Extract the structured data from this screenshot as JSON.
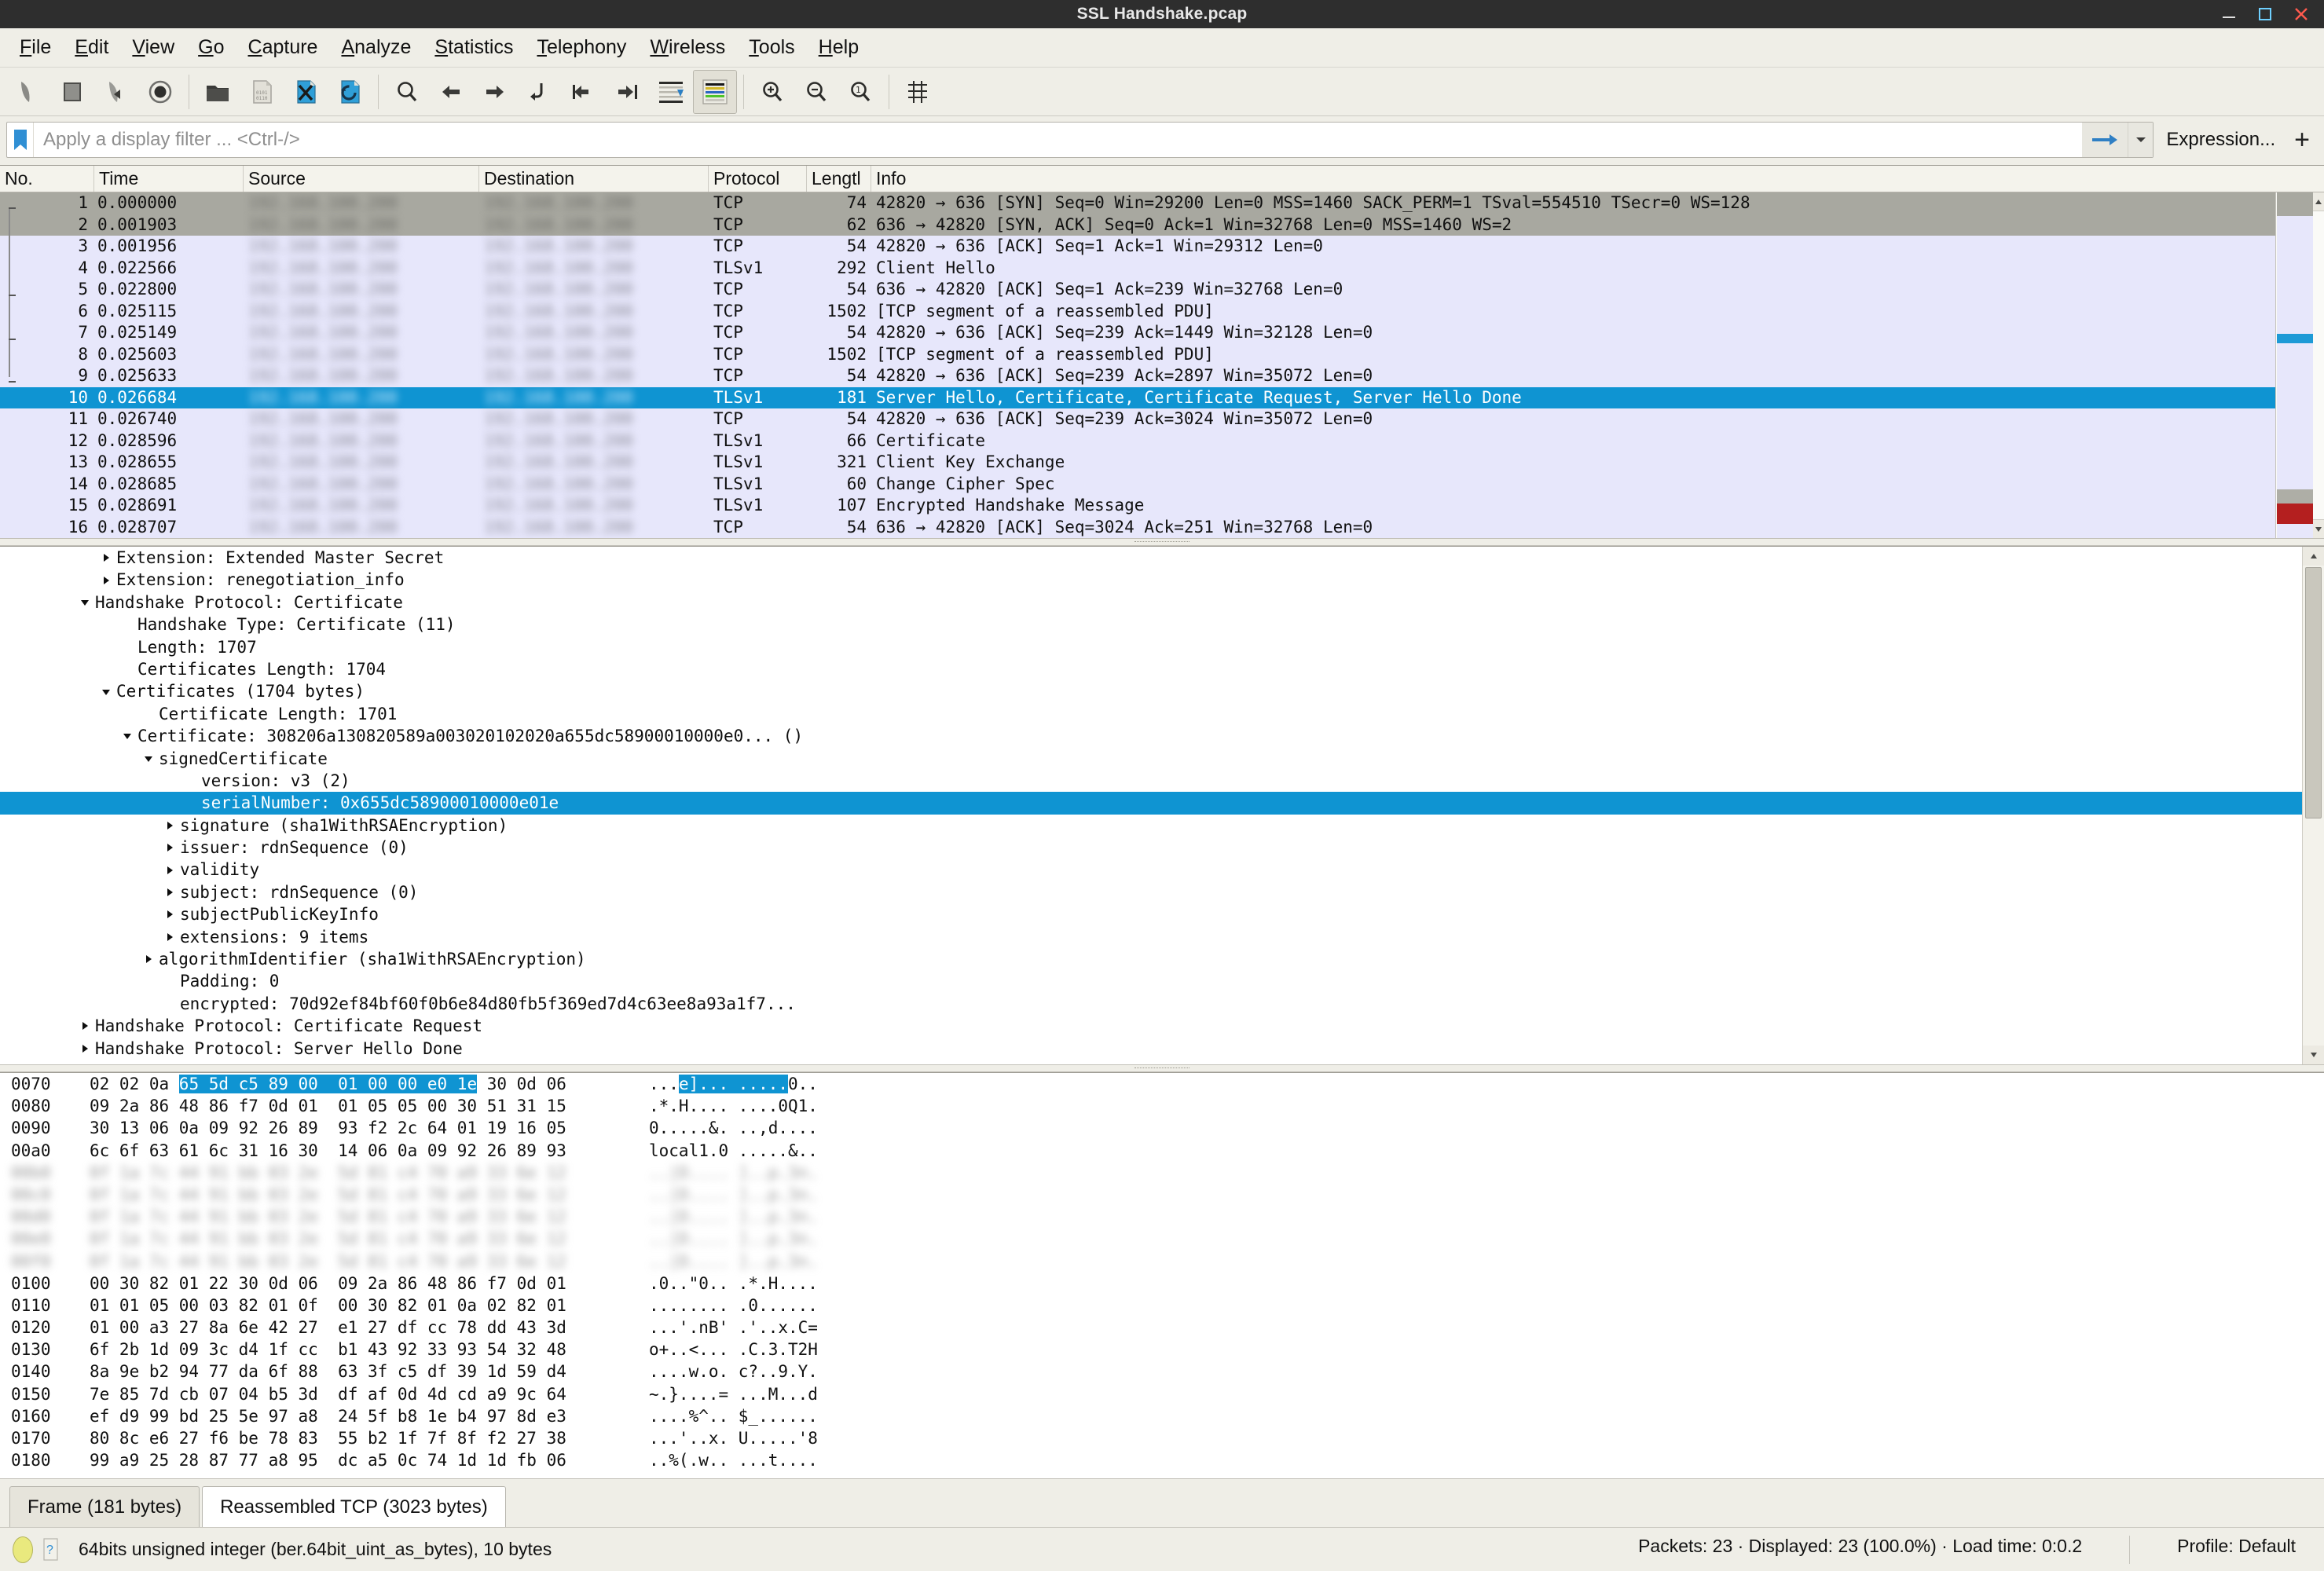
{
  "window": {
    "title": "SSL Handshake.pcap",
    "minimize_label": "Minimize",
    "maximize_label": "Maximize",
    "close_label": "Close"
  },
  "menubar": {
    "items": [
      {
        "label": "File",
        "mnemonic": "F"
      },
      {
        "label": "Edit",
        "mnemonic": "E"
      },
      {
        "label": "View",
        "mnemonic": "V"
      },
      {
        "label": "Go",
        "mnemonic": "G"
      },
      {
        "label": "Capture",
        "mnemonic": "C"
      },
      {
        "label": "Analyze",
        "mnemonic": "A"
      },
      {
        "label": "Statistics",
        "mnemonic": "S"
      },
      {
        "label": "Telephony",
        "mnemonic": "T"
      },
      {
        "label": "Wireless",
        "mnemonic": "W"
      },
      {
        "label": "Tools",
        "mnemonic": "T"
      },
      {
        "label": "Help",
        "mnemonic": "H"
      }
    ]
  },
  "toolbar": {
    "buttons": [
      {
        "icon": "start-capture-icon",
        "tooltip": "Start capturing packets"
      },
      {
        "icon": "stop-capture-icon",
        "tooltip": "Stop capturing packets"
      },
      {
        "icon": "restart-capture-icon",
        "tooltip": "Restart current capture"
      },
      {
        "icon": "capture-options-icon",
        "tooltip": "Capture options"
      },
      {
        "icon": "open-file-icon",
        "tooltip": "Open a capture file"
      },
      {
        "icon": "save-file-icon",
        "tooltip": "Save this capture file"
      },
      {
        "icon": "close-file-icon",
        "tooltip": "Close this capture file"
      },
      {
        "icon": "reload-file-icon",
        "tooltip": "Reload this file"
      },
      {
        "icon": "find-packet-icon",
        "tooltip": "Find a packet"
      },
      {
        "icon": "go-back-icon",
        "tooltip": "Go back in packet history"
      },
      {
        "icon": "go-forward-icon",
        "tooltip": "Go forward in packet history"
      },
      {
        "icon": "go-to-packet-icon",
        "tooltip": "Go to a specific packet"
      },
      {
        "icon": "go-first-packet-icon",
        "tooltip": "Go to the first packet"
      },
      {
        "icon": "go-last-packet-icon",
        "tooltip": "Go to the last packet"
      },
      {
        "icon": "auto-scroll-icon",
        "tooltip": "Auto scroll in live capture"
      },
      {
        "icon": "colorize-packets-icon",
        "tooltip": "Colorize packet list"
      },
      {
        "icon": "zoom-in-icon",
        "tooltip": "Zoom in"
      },
      {
        "icon": "zoom-out-icon",
        "tooltip": "Zoom out"
      },
      {
        "icon": "zoom-reset-icon",
        "tooltip": "Normal size"
      },
      {
        "icon": "resize-columns-icon",
        "tooltip": "Resize columns"
      }
    ]
  },
  "filterbar": {
    "bookmark_icon": "bookmark-icon",
    "placeholder": "Apply a display filter ... <Ctrl-/>",
    "value": "",
    "apply_icon": "apply-filter-arrow-icon",
    "dropdown_icon": "chevron-down-icon",
    "expression_label": "Expression...",
    "add_button_label": "+"
  },
  "packet_list": {
    "columns": [
      "No.",
      "Time",
      "Source",
      "Destination",
      "Protocol",
      "Lengtl",
      "Info"
    ],
    "rows": [
      {
        "no": "1",
        "time": "0.000000",
        "source": "",
        "destination": "",
        "protocol": "TCP",
        "length": "74",
        "info": "42820 → 636 [SYN] Seq=0 Win=29200 Len=0 MSS=1460 SACK_PERM=1 TSval=554510 TSecr=0 WS=128",
        "style": "grey"
      },
      {
        "no": "2",
        "time": "0.001903",
        "source": "",
        "destination": "",
        "protocol": "TCP",
        "length": "62",
        "info": "636 → 42820 [SYN, ACK] Seq=0 Ack=1 Win=32768 Len=0 MSS=1460 WS=2",
        "style": "grey"
      },
      {
        "no": "3",
        "time": "0.001956",
        "source": "",
        "destination": "",
        "protocol": "TCP",
        "length": "54",
        "info": "42820 → 636 [ACK] Seq=1 Ack=1 Win=29312 Len=0",
        "style": "lav"
      },
      {
        "no": "4",
        "time": "0.022566",
        "source": "",
        "destination": "",
        "protocol": "TLSv1",
        "length": "292",
        "info": "Client Hello",
        "style": "lav"
      },
      {
        "no": "5",
        "time": "0.022800",
        "source": "",
        "destination": "",
        "protocol": "TCP",
        "length": "54",
        "info": "636 → 42820 [ACK] Seq=1 Ack=239 Win=32768 Len=0",
        "style": "lav"
      },
      {
        "no": "6",
        "time": "0.025115",
        "source": "",
        "destination": "",
        "protocol": "TCP",
        "length": "1502",
        "info": "[TCP segment of a reassembled PDU]",
        "style": "lav"
      },
      {
        "no": "7",
        "time": "0.025149",
        "source": "",
        "destination": "",
        "protocol": "TCP",
        "length": "54",
        "info": "42820 → 636 [ACK] Seq=239 Ack=1449 Win=32128 Len=0",
        "style": "lav"
      },
      {
        "no": "8",
        "time": "0.025603",
        "source": "",
        "destination": "",
        "protocol": "TCP",
        "length": "1502",
        "info": "[TCP segment of a reassembled PDU]",
        "style": "lav"
      },
      {
        "no": "9",
        "time": "0.025633",
        "source": "",
        "destination": "",
        "protocol": "TCP",
        "length": "54",
        "info": "42820 → 636 [ACK] Seq=239 Ack=2897 Win=35072 Len=0",
        "style": "lav"
      },
      {
        "no": "10",
        "time": "0.026684",
        "source": "",
        "destination": "",
        "protocol": "TLSv1",
        "length": "181",
        "info": "Server Hello, Certificate, Certificate Request, Server Hello Done",
        "style": "sel"
      },
      {
        "no": "11",
        "time": "0.026740",
        "source": "",
        "destination": "",
        "protocol": "TCP",
        "length": "54",
        "info": "42820 → 636 [ACK] Seq=239 Ack=3024 Win=35072 Len=0",
        "style": "lav"
      },
      {
        "no": "12",
        "time": "0.028596",
        "source": "",
        "destination": "",
        "protocol": "TLSv1",
        "length": "66",
        "info": "Certificate",
        "style": "lav"
      },
      {
        "no": "13",
        "time": "0.028655",
        "source": "",
        "destination": "",
        "protocol": "TLSv1",
        "length": "321",
        "info": "Client Key Exchange",
        "style": "lav"
      },
      {
        "no": "14",
        "time": "0.028685",
        "source": "",
        "destination": "",
        "protocol": "TLSv1",
        "length": "60",
        "info": "Change Cipher Spec",
        "style": "lav"
      },
      {
        "no": "15",
        "time": "0.028691",
        "source": "",
        "destination": "",
        "protocol": "TLSv1",
        "length": "107",
        "info": "Encrypted Handshake Message",
        "style": "lav"
      },
      {
        "no": "16",
        "time": "0.028707",
        "source": "",
        "destination": "",
        "protocol": "TCP",
        "length": "54",
        "info": "636 → 42820 [ACK] Seq=3024 Ack=251 Win=32768 Len=0",
        "style": "lav"
      }
    ]
  },
  "packet_details": {
    "rows": [
      {
        "indent": 2,
        "arrow": "right",
        "label": "Extension: Extended Master Secret",
        "selected": false
      },
      {
        "indent": 2,
        "arrow": "right",
        "label": "Extension: renegotiation_info",
        "selected": false
      },
      {
        "indent": 1,
        "arrow": "down",
        "label": "Handshake Protocol: Certificate",
        "selected": false
      },
      {
        "indent": 3,
        "arrow": "none",
        "label": "Handshake Type: Certificate (11)",
        "selected": false
      },
      {
        "indent": 3,
        "arrow": "none",
        "label": "Length: 1707",
        "selected": false
      },
      {
        "indent": 3,
        "arrow": "none",
        "label": "Certificates Length: 1704",
        "selected": false
      },
      {
        "indent": 2,
        "arrow": "down",
        "label": "Certificates (1704 bytes)",
        "selected": false
      },
      {
        "indent": 4,
        "arrow": "none",
        "label": "Certificate Length: 1701",
        "selected": false
      },
      {
        "indent": 3,
        "arrow": "down",
        "label": "Certificate: 308206a130820589a003020102020a655dc58900010000e0... ()",
        "selected": false
      },
      {
        "indent": 4,
        "arrow": "down",
        "label": "signedCertificate",
        "selected": false
      },
      {
        "indent": 6,
        "arrow": "none",
        "label": "version: v3 (2)",
        "selected": false
      },
      {
        "indent": 6,
        "arrow": "none",
        "label": "serialNumber: 0x655dc58900010000e01e",
        "selected": true
      },
      {
        "indent": 5,
        "arrow": "right",
        "label": "signature (sha1WithRSAEncryption)",
        "selected": false
      },
      {
        "indent": 5,
        "arrow": "right",
        "label": "issuer: rdnSequence (0)",
        "selected": false
      },
      {
        "indent": 5,
        "arrow": "right",
        "label": "validity",
        "selected": false
      },
      {
        "indent": 5,
        "arrow": "right",
        "label": "subject: rdnSequence (0)",
        "selected": false
      },
      {
        "indent": 5,
        "arrow": "right",
        "label": "subjectPublicKeyInfo",
        "selected": false
      },
      {
        "indent": 5,
        "arrow": "right",
        "label": "extensions: 9 items",
        "selected": false
      },
      {
        "indent": 4,
        "arrow": "right",
        "label": "algorithmIdentifier (sha1WithRSAEncryption)",
        "selected": false
      },
      {
        "indent": 5,
        "arrow": "none",
        "label": "Padding: 0",
        "selected": false
      },
      {
        "indent": 5,
        "arrow": "none",
        "label": "encrypted: 70d92ef84bf60f0b6e84d80fb5f369ed7d4c63ee8a93a1f7...",
        "selected": false
      },
      {
        "indent": 1,
        "arrow": "right",
        "label": "Handshake Protocol: Certificate Request",
        "selected": false
      },
      {
        "indent": 1,
        "arrow": "right",
        "label": "Handshake Protocol: Server Hello Done",
        "selected": false
      }
    ]
  },
  "hex_pane": {
    "rows": [
      {
        "offset": "0070",
        "hex_pre": "02 02 0a ",
        "hex_hl": "65 5d c5 89 00  01 00 00 e0 1e",
        "hex_post": " 30 0d 06",
        "ascii_pre": "...",
        "ascii_hl": "e]... .....",
        "ascii_post": "0..",
        "blurred": false
      },
      {
        "offset": "0080",
        "hex_pre": "09 2a 86 48 86 f7 0d 01  01 05 05 00 30 51 31 15",
        "hex_hl": "",
        "hex_post": "",
        "ascii_pre": ".*.H.... ....0Q1.",
        "ascii_hl": "",
        "ascii_post": "",
        "blurred": false
      },
      {
        "offset": "0090",
        "hex_pre": "30 13 06 0a 09 92 26 89  93 f2 2c 64 01 19 16 05",
        "hex_hl": "",
        "hex_post": "",
        "ascii_pre": "0.....&. ..,d....",
        "ascii_hl": "",
        "ascii_post": "",
        "blurred": false
      },
      {
        "offset": "00a0",
        "hex_pre": "6c 6f 63 61 6c 31 16 30  14 06 0a 09 92 26 89 93",
        "hex_hl": "",
        "hex_post": "",
        "ascii_pre": "local1.0 .....&..",
        "ascii_hl": "",
        "ascii_post": "",
        "blurred": false
      },
      {
        "offset": "00b0",
        "hex_pre": "",
        "hex_hl": "",
        "hex_post": "",
        "ascii_pre": "",
        "ascii_hl": "",
        "ascii_post": "",
        "blurred": true
      },
      {
        "offset": "00c0",
        "hex_pre": "",
        "hex_hl": "",
        "hex_post": "",
        "ascii_pre": "",
        "ascii_hl": "",
        "ascii_post": "",
        "blurred": true
      },
      {
        "offset": "00d0",
        "hex_pre": "",
        "hex_hl": "",
        "hex_post": "",
        "ascii_pre": "",
        "ascii_hl": "",
        "ascii_post": "",
        "blurred": true
      },
      {
        "offset": "00e0",
        "hex_pre": "",
        "hex_hl": "",
        "hex_post": "",
        "ascii_pre": "",
        "ascii_hl": "",
        "ascii_post": "",
        "blurred": true
      },
      {
        "offset": "00f0",
        "hex_pre": "",
        "hex_hl": "",
        "hex_post": "",
        "ascii_pre": "",
        "ascii_hl": "",
        "ascii_post": "",
        "blurred": true
      },
      {
        "offset": "0100",
        "hex_pre": "00 30 82 01 22 30 0d 06  09 2a 86 48 86 f7 0d 01",
        "hex_hl": "",
        "hex_post": "",
        "ascii_pre": ".0..\"0.. .*.H....",
        "ascii_hl": "",
        "ascii_post": "",
        "blurred": false
      },
      {
        "offset": "0110",
        "hex_pre": "01 01 05 00 03 82 01 0f  00 30 82 01 0a 02 82 01",
        "hex_hl": "",
        "hex_post": "",
        "ascii_pre": "........ .0......",
        "ascii_hl": "",
        "ascii_post": "",
        "blurred": false
      },
      {
        "offset": "0120",
        "hex_pre": "01 00 a3 27 8a 6e 42 27  e1 27 df cc 78 dd 43 3d",
        "hex_hl": "",
        "hex_post": "",
        "ascii_pre": "...'.nB' .'..x.C=",
        "ascii_hl": "",
        "ascii_post": "",
        "blurred": false
      },
      {
        "offset": "0130",
        "hex_pre": "6f 2b 1d 09 3c d4 1f cc  b1 43 92 33 93 54 32 48",
        "hex_hl": "",
        "hex_post": "",
        "ascii_pre": "o+..<... .C.3.T2H",
        "ascii_hl": "",
        "ascii_post": "",
        "blurred": false
      },
      {
        "offset": "0140",
        "hex_pre": "8a 9e b2 94 77 da 6f 88  63 3f c5 df 39 1d 59 d4",
        "hex_hl": "",
        "hex_post": "",
        "ascii_pre": "....w.o. c?..9.Y.",
        "ascii_hl": "",
        "ascii_post": "",
        "blurred": false
      },
      {
        "offset": "0150",
        "hex_pre": "7e 85 7d cb 07 04 b5 3d  df af 0d 4d cd a9 9c 64",
        "hex_hl": "",
        "hex_post": "",
        "ascii_pre": "~.}....= ...M...d",
        "ascii_hl": "",
        "ascii_post": "",
        "blurred": false
      },
      {
        "offset": "0160",
        "hex_pre": "ef d9 99 bd 25 5e 97 a8  24 5f b8 1e b4 97 8d e3",
        "hex_hl": "",
        "hex_post": "",
        "ascii_pre": "....%^.. $_......",
        "ascii_hl": "",
        "ascii_post": "",
        "blurred": false
      },
      {
        "offset": "0170",
        "hex_pre": "80 8c e6 27 f6 be 78 83  55 b2 1f 7f 8f f2 27 38",
        "hex_hl": "",
        "hex_post": "",
        "ascii_pre": "...'..x. U.....'8",
        "ascii_hl": "",
        "ascii_post": "",
        "blurred": false
      },
      {
        "offset": "0180",
        "hex_pre": "99 a9 25 28 87 77 a8 95  dc a5 0c 74 1d 1d fb 06",
        "hex_hl": "",
        "hex_post": "",
        "ascii_pre": "..%(.w.. ...t....",
        "ascii_hl": "",
        "ascii_post": "",
        "blurred": false
      }
    ]
  },
  "tabs": [
    {
      "label": "Frame (181 bytes)",
      "active": false
    },
    {
      "label": "Reassembled TCP (3023 bytes)",
      "active": true
    }
  ],
  "statusbar": {
    "expert_icon": "expert-info-icon",
    "help_icon": "field-help-icon",
    "field_text": "64bits unsigned integer (ber.64bit_uint_as_bytes), 10 bytes",
    "packets_text": "Packets: 23 · Displayed: 23 (100.0%) · Load time: 0:0.2",
    "profile_text": "Profile: Default"
  },
  "colors": {
    "selection_blue": "#0f94d2",
    "row_lavender": "#e7e7fb",
    "row_grey": "#a8a8a0",
    "chrome": "#efeee7",
    "titlebar": "#2e2e2e"
  }
}
